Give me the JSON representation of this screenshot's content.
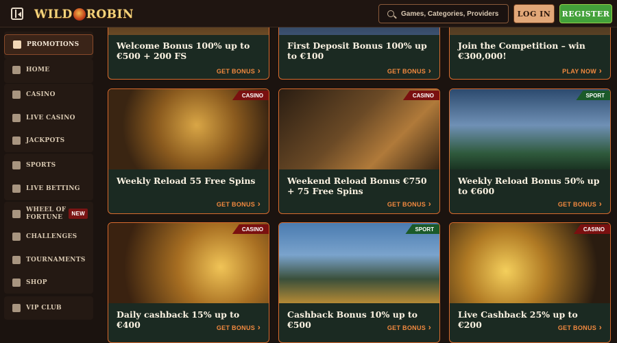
{
  "header": {
    "logo_text": "WILDROBIN",
    "search_placeholder": "Games, Categories, Providers",
    "login_label": "LOG IN",
    "register_label": "REGISTER"
  },
  "sidebar": {
    "items": [
      {
        "label": "PROMOTIONS",
        "icon": "gift-icon",
        "active": true
      },
      {
        "label": "HOME",
        "icon": "home-icon"
      },
      {
        "label": "CASINO",
        "icon": "casino-icon"
      },
      {
        "label": "LIVE CASINO",
        "icon": "cards-icon"
      },
      {
        "label": "JACKPOTS",
        "icon": "jackpot-icon"
      },
      {
        "label": "SPORTS",
        "icon": "ball-icon"
      },
      {
        "label": "LIVE BETTING",
        "icon": "live-icon"
      },
      {
        "label": "WHEEL OF FORTUNE",
        "icon": "wheel-icon",
        "badge": "NEW"
      },
      {
        "label": "CHALLENGES",
        "icon": "target-icon"
      },
      {
        "label": "TOURNAMENTS",
        "icon": "trophy-icon"
      },
      {
        "label": "SHOP",
        "icon": "bag-icon"
      },
      {
        "label": "VIP CLUB",
        "icon": "diamond-icon"
      }
    ]
  },
  "promotions": [
    {
      "title": "Welcome Bonus 100% up to €500 + 200 FS",
      "cta": "GET BONUS"
    },
    {
      "title": "First Deposit Bonus 100% up to €100",
      "cta": "GET BONUS"
    },
    {
      "title": "Join the Competition – win €300,000!",
      "cta": "PLAY NOW"
    },
    {
      "title": "Weekly Reload 55 Free Spins",
      "cta": "GET BONUS",
      "tag": "CASINO"
    },
    {
      "title": "Weekend Reload Bonus €750 + 75 Free Spins",
      "cta": "GET BONUS",
      "tag": "CASINO"
    },
    {
      "title": "Weekly Reload Bonus 50% up to €600",
      "cta": "GET BONUS",
      "tag": "SPORT"
    },
    {
      "title": "Daily cashback 15% up to €400",
      "cta": "GET BONUS",
      "tag": "CASINO"
    },
    {
      "title": "Cashback Bonus 10% up to €500",
      "cta": "GET BONUS",
      "tag": "SPORT"
    },
    {
      "title": "Live Cashback 25% up to €200",
      "cta": "GET BONUS",
      "tag": "CASINO"
    }
  ],
  "colors": {
    "accent": "#f2893f",
    "register": "#43a13a",
    "casino_tag": "#7a1010",
    "sport_tag": "#1b5a2a"
  }
}
